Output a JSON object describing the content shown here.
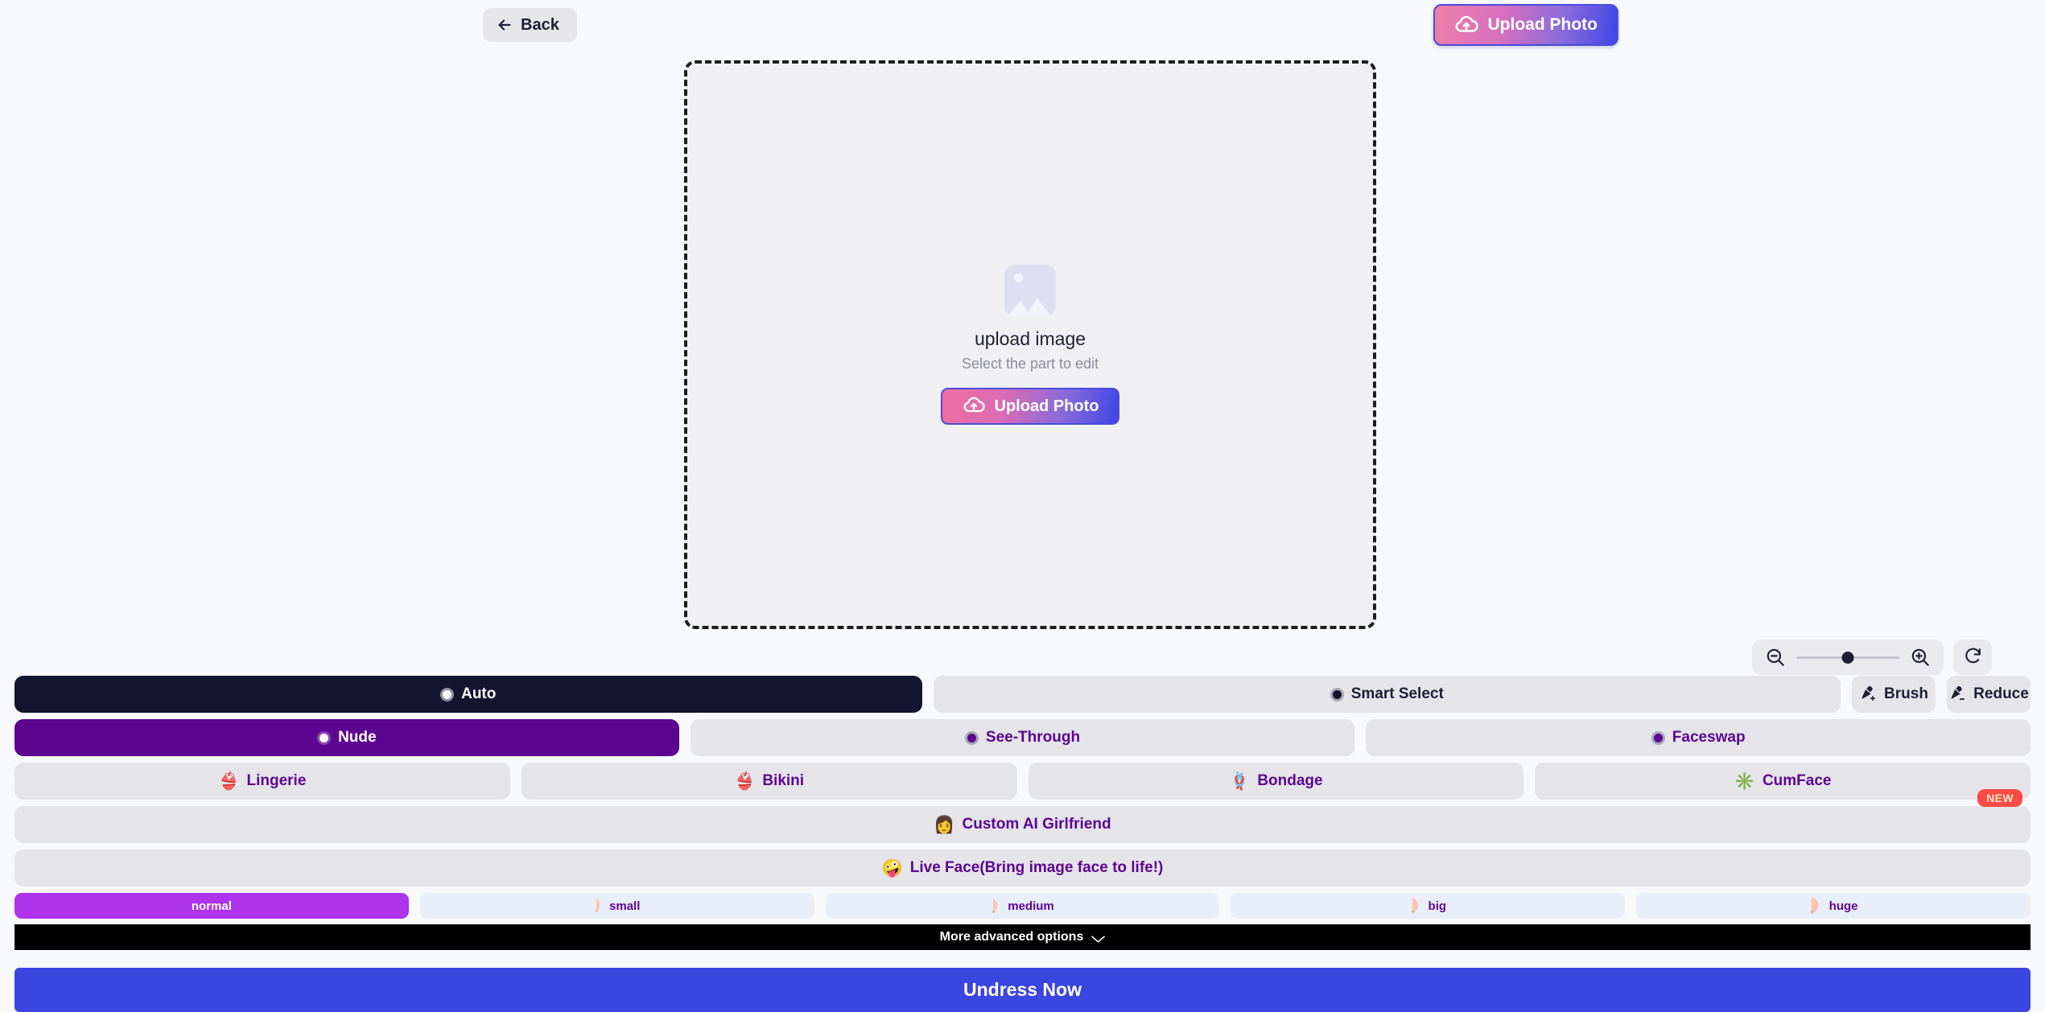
{
  "header": {
    "back_label": "Back",
    "back_icon": "arrow-left-icon",
    "upload_label": "Upload Photo",
    "upload_icon": "cloud-upload-icon",
    "upload_gradient_from": "#ef7fa8",
    "upload_gradient_to": "#3f46e8"
  },
  "dropzone": {
    "placeholder_icon": "image-placeholder-icon",
    "title": "upload image",
    "subtitle": "Select the part to edit",
    "upload_label": "Upload Photo",
    "upload_icon": "cloud-upload-icon"
  },
  "zoom_controls": {
    "zoom_out_icon": "zoom-out-icon",
    "zoom_in_icon": "zoom-in-icon",
    "rotate_icon": "rotate-clockwise-icon",
    "slider_value": "50"
  },
  "selection_modes": [
    {
      "label": "Auto",
      "state": "active",
      "icon": "radio-selected-icon"
    },
    {
      "label": "Smart Select",
      "state": "inactive",
      "icon": "radio-icon"
    }
  ],
  "tools": [
    {
      "label": "Brush",
      "icon": "brush-add-icon"
    },
    {
      "label": "Reduce",
      "icon": "brush-reduce-icon"
    }
  ],
  "modes": [
    {
      "label": "Nude",
      "state": "active",
      "icon": "radio-selected-icon"
    },
    {
      "label": "See-Through",
      "state": "inactive",
      "icon": "radio-icon"
    },
    {
      "label": "Faceswap",
      "state": "inactive",
      "icon": "radio-icon"
    }
  ],
  "outfits": [
    {
      "label": "Lingerie",
      "emoji": "👙",
      "icon": "lingerie-icon"
    },
    {
      "label": "Bikini",
      "emoji": "👙",
      "icon": "bikini-icon"
    },
    {
      "label": "Bondage",
      "emoji": "🪢",
      "icon": "bondage-rope-icon"
    },
    {
      "label": "CumFace",
      "emoji": "✳️",
      "icon": "cumface-splash-icon"
    }
  ],
  "wide_options": [
    {
      "label": "Custom AI Girlfriend",
      "emoji": "👩",
      "icon": "ai-girlfriend-icon",
      "badge": "NEW"
    },
    {
      "label": "Live Face(Bring image face to life!)",
      "emoji": "🤪",
      "icon": "live-face-icon",
      "badge": ""
    }
  ],
  "breast_sizes": [
    {
      "label": "normal",
      "state": "active",
      "icon": "breast-size-icon"
    },
    {
      "label": "small",
      "state": "inactive",
      "icon": "breast-size-icon"
    },
    {
      "label": "medium",
      "state": "inactive",
      "icon": "breast-size-icon"
    },
    {
      "label": "big",
      "state": "inactive",
      "icon": "breast-size-icon"
    },
    {
      "label": "huge",
      "state": "inactive",
      "icon": "breast-size-icon"
    }
  ],
  "advanced": {
    "label": "More advanced options",
    "icon": "chevron-down-icon"
  },
  "submit": {
    "label": "Undress Now",
    "color": "#3b45e0"
  },
  "colors": {
    "accent_purple": "#5c0590",
    "active_magenta": "#ad33ed",
    "dark_navy": "#141430",
    "badge_red": "#fa4b44",
    "page_bg": "#f8f9fc"
  }
}
